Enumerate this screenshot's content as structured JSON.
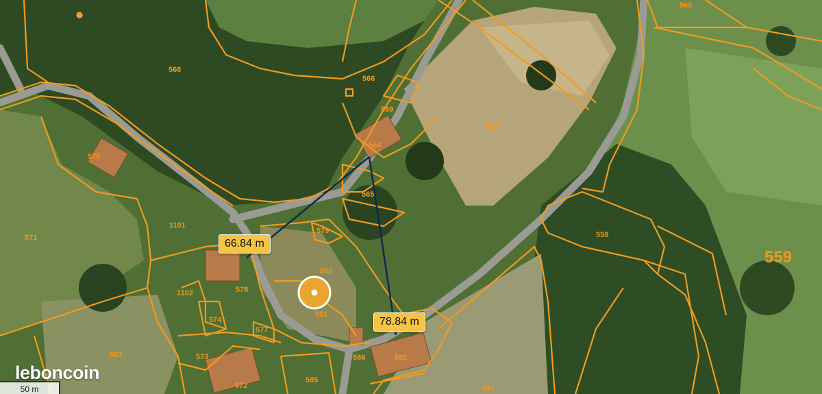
{
  "map": {
    "parcels": [
      {
        "id": "p560",
        "label": "560"
      },
      {
        "id": "p568",
        "label": "568"
      },
      {
        "id": "p566",
        "label": "566"
      },
      {
        "id": "p569",
        "label": "569"
      },
      {
        "id": "p564",
        "label": "564"
      },
      {
        "id": "p562",
        "label": "562"
      },
      {
        "id": "p576",
        "label": "576"
      },
      {
        "id": "p565",
        "label": "565"
      },
      {
        "id": "p579",
        "label": "579"
      },
      {
        "id": "p571",
        "label": "571"
      },
      {
        "id": "p1101",
        "label": "1101"
      },
      {
        "id": "p558",
        "label": "558"
      },
      {
        "id": "p559",
        "label": "559"
      },
      {
        "id": "p580",
        "label": "580"
      },
      {
        "id": "p578",
        "label": "578"
      },
      {
        "id": "p581",
        "label": "581"
      },
      {
        "id": "p1102",
        "label": "1102"
      },
      {
        "id": "p574",
        "label": "574"
      },
      {
        "id": "p577",
        "label": "577"
      },
      {
        "id": "p583",
        "label": "583"
      },
      {
        "id": "p573",
        "label": "573"
      },
      {
        "id": "p572",
        "label": "572"
      },
      {
        "id": "p585",
        "label": "585"
      },
      {
        "id": "p582",
        "label": "582"
      },
      {
        "id": "p586",
        "label": "586"
      },
      {
        "id": "p584",
        "label": "584"
      }
    ],
    "measurements": [
      {
        "id": "m1",
        "label": "66.84 m"
      },
      {
        "id": "m2",
        "label": "78.84 m"
      }
    ],
    "scale": {
      "label": "50 m"
    },
    "brand": "leboncoin",
    "colors": {
      "parcel_line": "#f29b1d",
      "measure_line": "#0e2a52",
      "measure_label_bg": "#f6c545",
      "marker": "#e8a530"
    }
  }
}
